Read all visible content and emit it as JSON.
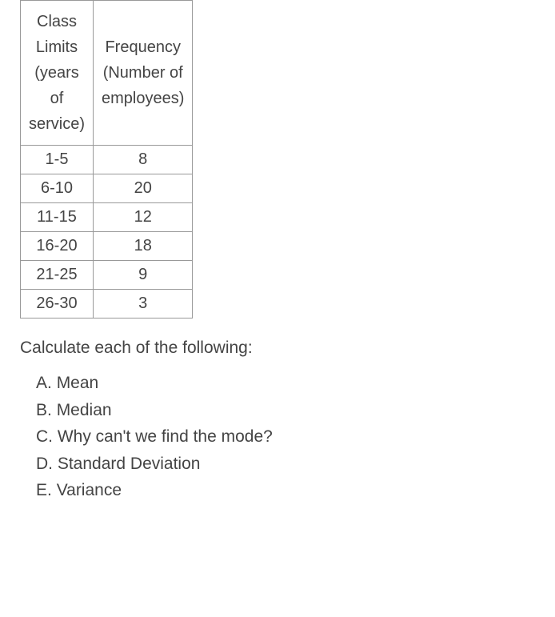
{
  "chart_data": {
    "type": "table",
    "title": "",
    "columns": [
      {
        "main": "Class Limits",
        "sub": "(years of service)"
      },
      {
        "main": "Frequency",
        "sub": "(Number of employees)"
      }
    ],
    "rows": [
      {
        "limits": "1-5",
        "freq": "8"
      },
      {
        "limits": "6-10",
        "freq": "20"
      },
      {
        "limits": "11-15",
        "freq": "12"
      },
      {
        "limits": "16-20",
        "freq": "18"
      },
      {
        "limits": "21-25",
        "freq": "9"
      },
      {
        "limits": "26-30",
        "freq": "3"
      }
    ]
  },
  "instruction": "Calculate each of the following:",
  "options": [
    {
      "label": "A.",
      "text": "Mean"
    },
    {
      "label": "B.",
      "text": "Median"
    },
    {
      "label": "C.",
      "text": "Why can't we find the mode?"
    },
    {
      "label": "D.",
      "text": "Standard Deviation"
    },
    {
      "label": "E.",
      "text": "Variance"
    }
  ]
}
